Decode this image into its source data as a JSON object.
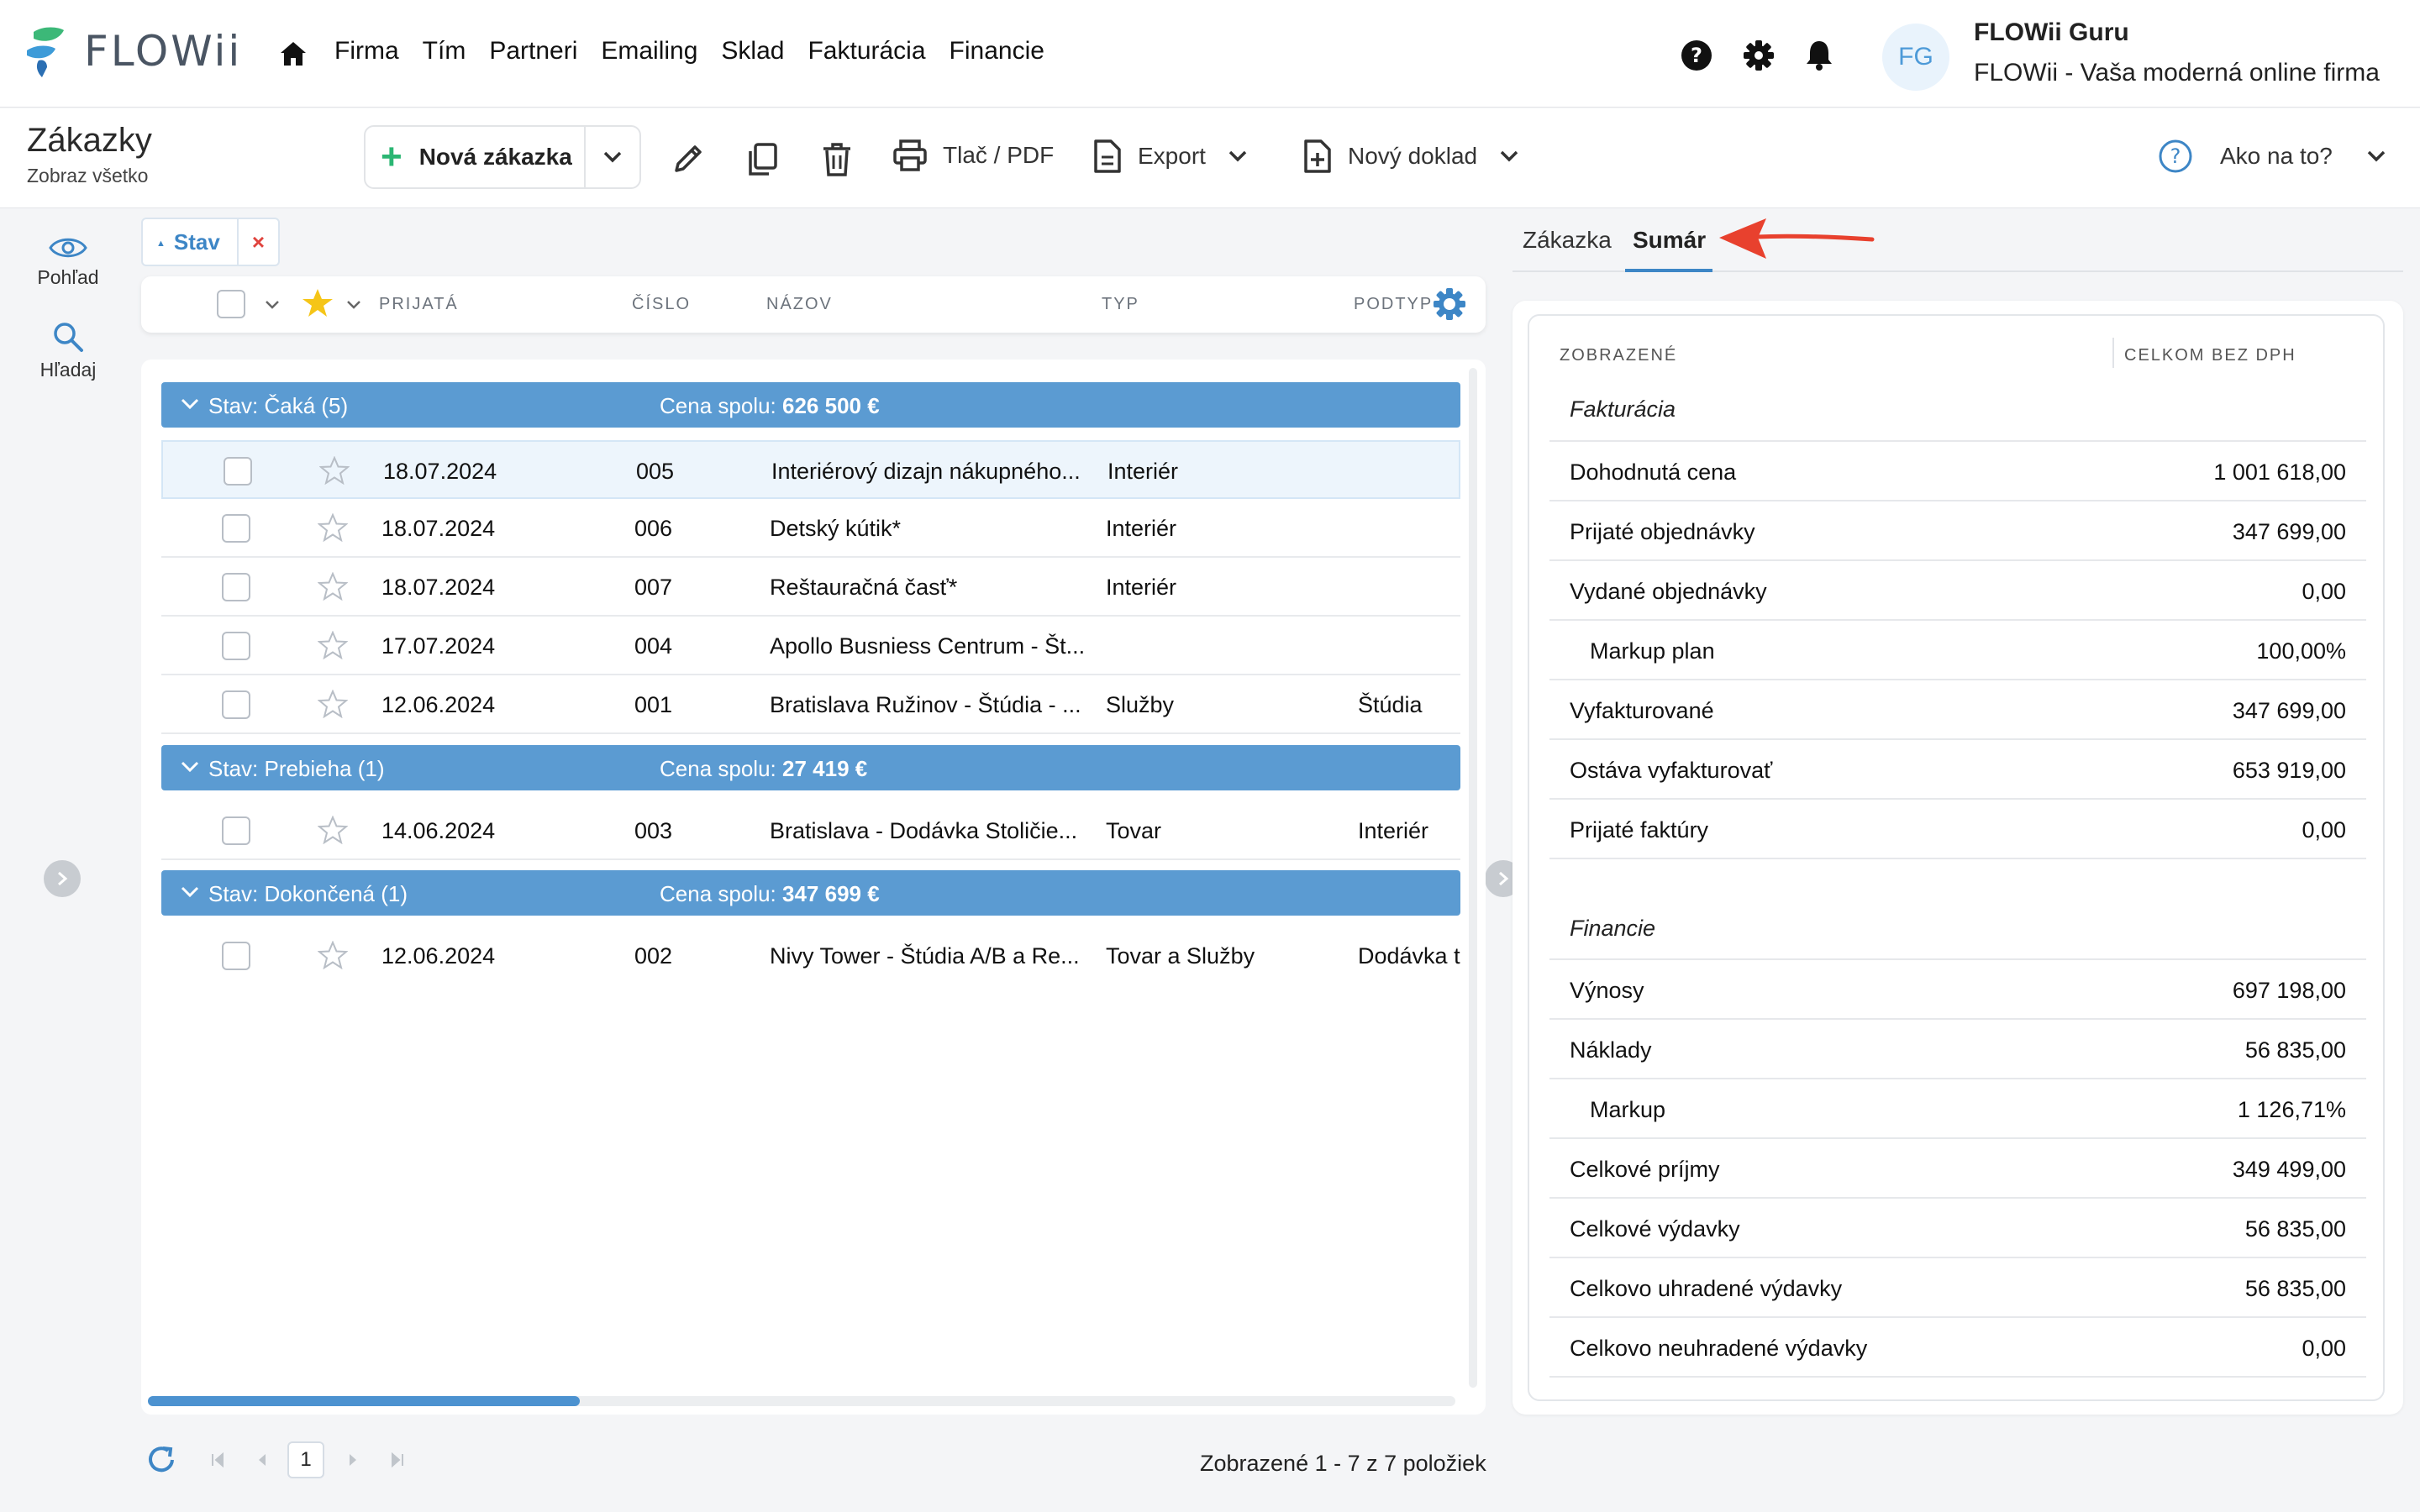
{
  "app": {
    "logo_text": "FLOWii",
    "menu": [
      "Firma",
      "Tím",
      "Partneri",
      "Emailing",
      "Sklad",
      "Fakturácia",
      "Financie"
    ],
    "user": {
      "initials": "FG",
      "name": "FLOWii Guru",
      "company": "FLOWii - Vaša moderná online firma"
    }
  },
  "toolbar": {
    "title": "Zákazky",
    "subtitle": "Zobraz všetko",
    "new_label": "Nová zákazka",
    "print_label": "Tlač / PDF",
    "export_label": "Export",
    "new_doc_label": "Nový doklad",
    "help_label": "Ako na to?"
  },
  "rail": {
    "view_label": "Pohľad",
    "search_label": "Hľadaj"
  },
  "filter": {
    "chip_label": "Stav",
    "remove": "×"
  },
  "grid": {
    "columns": [
      "PRIJATÁ",
      "ČÍSLO",
      "NÁZOV",
      "TYP",
      "PODTYP"
    ],
    "groups": [
      {
        "label": "Stav: Čaká (5)",
        "sum_label": "Cena spolu:",
        "sum_value": "626 500 €",
        "rows": [
          {
            "date": "18.07.2024",
            "num": "005",
            "name": "Interiérový dizajn nákupného...",
            "type": "Interiér",
            "subtype": ""
          },
          {
            "date": "18.07.2024",
            "num": "006",
            "name": "Detský kútik*",
            "type": "Interiér",
            "subtype": ""
          },
          {
            "date": "18.07.2024",
            "num": "007",
            "name": "Reštauračná časť*",
            "type": "Interiér",
            "subtype": ""
          },
          {
            "date": "17.07.2024",
            "num": "004",
            "name": "Apollo Busniess Centrum - Št...",
            "type": "",
            "subtype": ""
          },
          {
            "date": "12.06.2024",
            "num": "001",
            "name": "Bratislava Ružinov - Štúdia - ...",
            "type": "Služby",
            "subtype": "Štúdia"
          }
        ]
      },
      {
        "label": "Stav: Prebieha (1)",
        "sum_label": "Cena spolu:",
        "sum_value": "27 419 €",
        "rows": [
          {
            "date": "14.06.2024",
            "num": "003",
            "name": "Bratislava - Dodávka Stoličie...",
            "type": "Tovar",
            "subtype": "Interiér"
          }
        ]
      },
      {
        "label": "Stav: Dokončená (1)",
        "sum_label": "Cena spolu:",
        "sum_value": "347 699 €",
        "rows": [
          {
            "date": "12.06.2024",
            "num": "002",
            "name": "Nivy Tower - Štúdia A/B a Re...",
            "type": "Tovar a Služby",
            "subtype": "Dodávka t"
          }
        ]
      }
    ]
  },
  "pager": {
    "page": "1",
    "info": "Zobrazené 1 - 7 z 7 položiek"
  },
  "right": {
    "tabs": [
      "Zákazka",
      "Sumár"
    ],
    "active_tab": "Sumár",
    "head_left": "ZOBRAZENÉ",
    "head_right": "CELKOM BEZ DPH",
    "fakturacia": {
      "title": "Fakturácia",
      "rows": [
        {
          "k": "Dohodnutá cena",
          "v": "1 001 618,00",
          "indent": false
        },
        {
          "k": "Prijaté objednávky",
          "v": "347 699,00",
          "indent": false
        },
        {
          "k": "Vydané objednávky",
          "v": "0,00",
          "indent": false
        },
        {
          "k": "Markup plan",
          "v": "100,00%",
          "indent": true
        },
        {
          "k": "Vyfakturované",
          "v": "347 699,00",
          "indent": false
        },
        {
          "k": "Ostáva vyfakturovať",
          "v": "653 919,00",
          "indent": false
        },
        {
          "k": "Prijaté faktúry",
          "v": "0,00",
          "indent": false
        }
      ]
    },
    "financie": {
      "title": "Financie",
      "rows": [
        {
          "k": "Výnosy",
          "v": "697 198,00",
          "indent": false
        },
        {
          "k": "Náklady",
          "v": "56 835,00",
          "indent": false
        },
        {
          "k": "Markup",
          "v": "1 126,71%",
          "indent": true
        },
        {
          "k": "Celkové príjmy",
          "v": "349 499,00",
          "indent": false
        },
        {
          "k": "Celkové výdavky",
          "v": "56 835,00",
          "indent": false
        },
        {
          "k": "Celkovo uhradené výdavky",
          "v": "56 835,00",
          "indent": false
        },
        {
          "k": "Celkovo neuhradené výdavky",
          "v": "0,00",
          "indent": false
        }
      ]
    }
  },
  "colors": {
    "accent": "#3d86c6",
    "group": "#5b9bd2",
    "green": "#2bb673",
    "red": "#e8412e",
    "star": "#f5c518"
  }
}
